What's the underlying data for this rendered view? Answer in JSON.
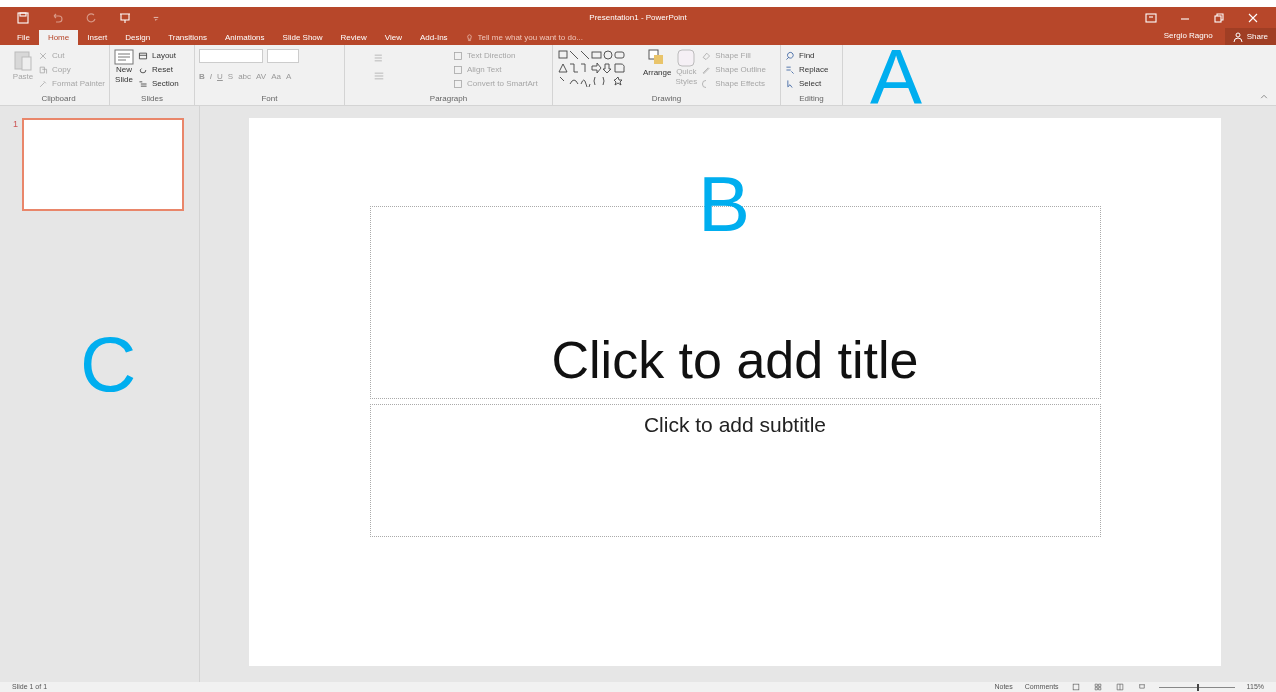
{
  "window": {
    "title": "Presentation1 - PowerPoint",
    "user": "Sergio Ragno",
    "share": "Share"
  },
  "tabs": [
    {
      "label": "File",
      "selected": false
    },
    {
      "label": "Home",
      "selected": true
    },
    {
      "label": "Insert",
      "selected": false
    },
    {
      "label": "Design",
      "selected": false
    },
    {
      "label": "Transitions",
      "selected": false
    },
    {
      "label": "Animations",
      "selected": false
    },
    {
      "label": "Slide Show",
      "selected": false
    },
    {
      "label": "Review",
      "selected": false
    },
    {
      "label": "View",
      "selected": false
    },
    {
      "label": "Add-Ins",
      "selected": false
    }
  ],
  "tell_me": {
    "placeholder": "Tell me what you want to do..."
  },
  "ribbon": {
    "clipboard": {
      "name": "Clipboard",
      "paste": "Paste",
      "items": [
        {
          "label": "Cut",
          "disabled": true
        },
        {
          "label": "Copy",
          "disabled": true
        },
        {
          "label": "Format Painter",
          "disabled": true
        }
      ]
    },
    "slides": {
      "name": "Slides",
      "new_slide": [
        "New",
        "Slide"
      ],
      "items": [
        {
          "label": "Layout"
        },
        {
          "label": "Reset"
        },
        {
          "label": "Section"
        }
      ]
    },
    "font": {
      "name": "Font",
      "format_buttons": [
        "B",
        "I",
        "U",
        "S",
        "abc",
        "AV",
        "Aa",
        "A"
      ]
    },
    "paragraph": {
      "name": "Paragraph",
      "items": [
        {
          "label": "Text Direction"
        },
        {
          "label": "Align Text"
        },
        {
          "label": "Convert to SmartArt"
        }
      ]
    },
    "drawing": {
      "name": "Drawing",
      "arrange": "Arrange",
      "quick_styles": [
        "Quick",
        "Styles"
      ],
      "items": [
        {
          "label": "Shape Fill"
        },
        {
          "label": "Shape Outline"
        },
        {
          "label": "Shape Effects"
        }
      ]
    },
    "editing": {
      "name": "Editing",
      "items": [
        {
          "label": "Find",
          "disabled": false
        },
        {
          "label": "Replace",
          "disabled": false
        },
        {
          "label": "Select",
          "disabled": false
        }
      ]
    }
  },
  "thumbnails": [
    {
      "number": "1",
      "selected": true
    }
  ],
  "slide": {
    "title_placeholder": "Click to add title",
    "subtitle_placeholder": "Click to add subtitle"
  },
  "status_bar": {
    "slide_info": "Slide 1 of 1",
    "notes": "Notes",
    "comments": "Comments",
    "zoom": "115%",
    "zoom_level": {
      "level": 0.5
    }
  },
  "annotations": [
    {
      "label": "A"
    },
    {
      "label": "B"
    },
    {
      "label": "C"
    }
  ]
}
